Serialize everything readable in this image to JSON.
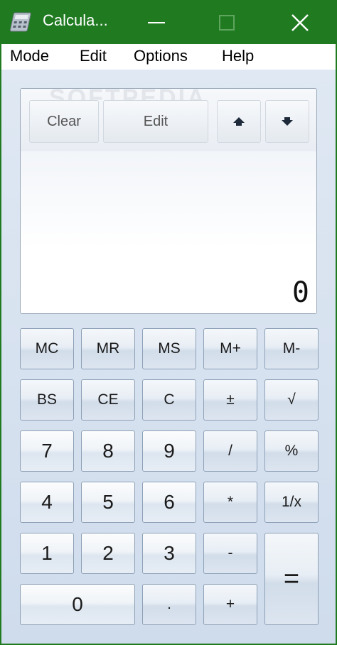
{
  "window": {
    "title": "Calcula...",
    "colors": {
      "titlebar": "#1f7a20",
      "client_bg": "#dfe8f3",
      "key_border": "#8da0b6"
    }
  },
  "menu": [
    "Mode",
    "Edit",
    "Options",
    "Help"
  ],
  "history_bar": {
    "clear_label": "Clear",
    "edit_label": "Edit",
    "up_icon": "up-arrow-icon",
    "down_icon": "down-arrow-icon"
  },
  "watermark": "SOFTPEDIA",
  "display": {
    "value": "0"
  },
  "keys": {
    "mc": "MC",
    "mr": "MR",
    "ms": "MS",
    "mplus": "M+",
    "mminus": "M-",
    "bs": "BS",
    "ce": "CE",
    "c": "C",
    "plusminus": "±",
    "sqrt": "√",
    "k7": "7",
    "k8": "8",
    "k9": "9",
    "div": "/",
    "pct": "%",
    "k4": "4",
    "k5": "5",
    "k6": "6",
    "mul": "*",
    "recip": "1/x",
    "k1": "1",
    "k2": "2",
    "k3": "3",
    "sub": "-",
    "k0": "0",
    "dot": ".",
    "add": "+",
    "eq": "="
  }
}
